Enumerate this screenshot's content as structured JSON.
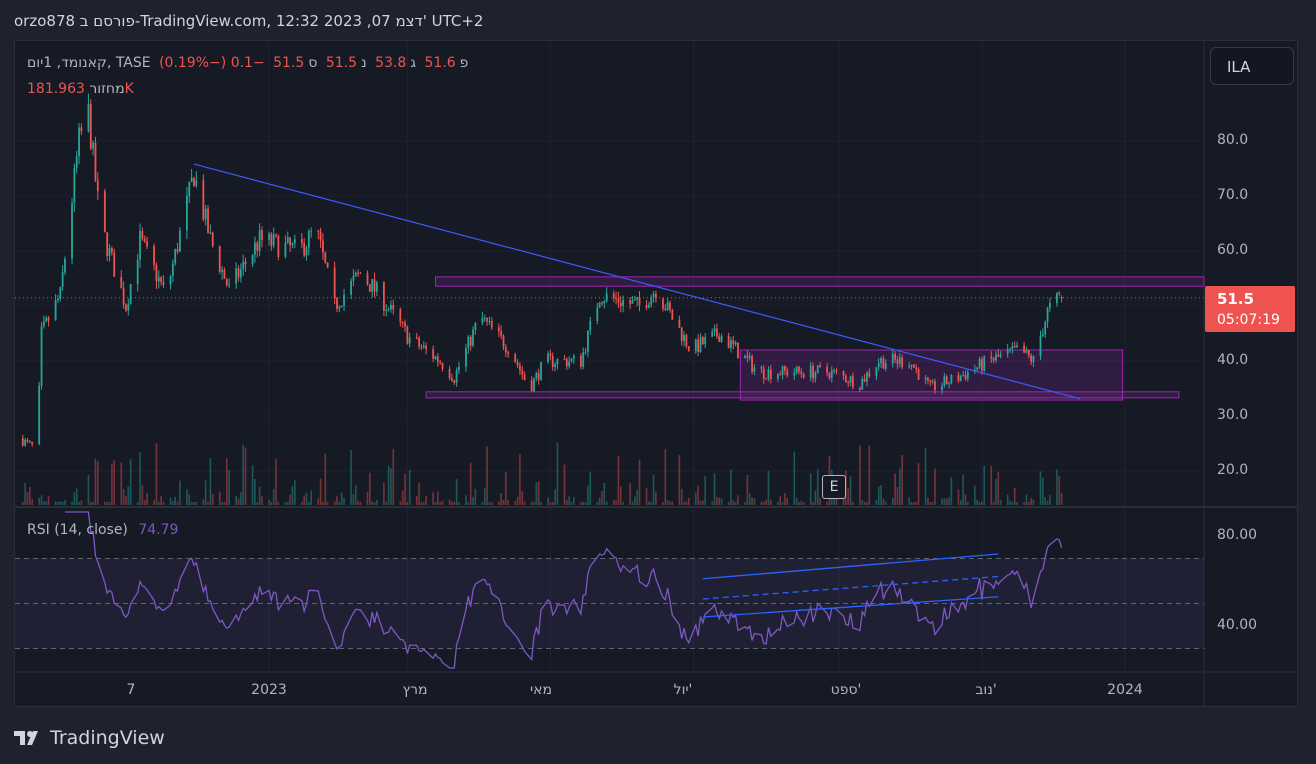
{
  "header": {
    "title": "orzo878 פורסם ב-TradingView.com, 12:32 2023 ,07 דצמ' UTC+2"
  },
  "legend": {
    "symbol": "קאנומד, 1יום, TASE",
    "o_label": "פ",
    "o": "51.6",
    "h_label": "ג",
    "h": "53.8",
    "l_label": "נ",
    "l": "51.5",
    "c_label": "ס",
    "c": "51.5",
    "change": "−0.1 (−0.19%)",
    "volume_label": "מחזור",
    "volume": "181.963K"
  },
  "rsi_legend": {
    "label": "RSI (14, close)",
    "value": "74.79"
  },
  "currency": "ILA",
  "price_axis": [
    "80.0",
    "70.0",
    "60.0",
    "40.0",
    "30.0",
    "20.0"
  ],
  "rsi_axis": [
    "80.00",
    "40.00"
  ],
  "last_price": {
    "price": "51.5",
    "countdown": "05:07:19"
  },
  "event_marker": "E",
  "time_axis": [
    {
      "label": "7",
      "day": -177
    },
    {
      "label": "2023",
      "day": 0
    },
    {
      "label": "מרץ",
      "day": 59
    },
    {
      "label": "מאי",
      "day": 120
    },
    {
      "label": "יול'",
      "day": 181
    },
    {
      "label": "ספט'",
      "day": 243
    },
    {
      "label": "נוב'",
      "day": 304
    },
    {
      "label": "2024",
      "day": 365
    }
  ],
  "footer": {
    "brand": "TradingView"
  },
  "colors": {
    "up": "#26a69a",
    "down": "#ef5350",
    "trend": "#3d5afe",
    "zone": "#9c27b0",
    "rsi": "#7e57c2"
  },
  "chart_data": {
    "type": "candlestick",
    "x_unit": "days from 2023-01-01",
    "close_anchors": [
      [
        -107,
        26
      ],
      [
        -99,
        24
      ],
      [
        -97,
        45
      ],
      [
        -89,
        52
      ],
      [
        -81,
        80
      ],
      [
        -77,
        85
      ],
      [
        -72,
        65
      ],
      [
        -61,
        50
      ],
      [
        -55,
        62
      ],
      [
        -44,
        52
      ],
      [
        -32,
        74
      ],
      [
        -25,
        62
      ],
      [
        -17,
        53
      ],
      [
        -4,
        62
      ],
      [
        13,
        60
      ],
      [
        20,
        64
      ],
      [
        28,
        50
      ],
      [
        39,
        56
      ],
      [
        47,
        52
      ],
      [
        60,
        44
      ],
      [
        73,
        40
      ],
      [
        79,
        37
      ],
      [
        90,
        48
      ],
      [
        103,
        42
      ],
      [
        111,
        35
      ],
      [
        118,
        40
      ],
      [
        133,
        40
      ],
      [
        141,
        52
      ],
      [
        158,
        50
      ],
      [
        165,
        53
      ],
      [
        180,
        42
      ],
      [
        192,
        45
      ],
      [
        209,
        38
      ],
      [
        226,
        38
      ],
      [
        239,
        38
      ],
      [
        252,
        36
      ],
      [
        260,
        40
      ],
      [
        273,
        40
      ],
      [
        282,
        35
      ],
      [
        294,
        37
      ],
      [
        307,
        40
      ],
      [
        320,
        42
      ],
      [
        326,
        40
      ],
      [
        332,
        49
      ],
      [
        338,
        52
      ]
    ],
    "last": {
      "open": 51.6,
      "high": 53.8,
      "low": 51.5,
      "close": 51.5,
      "volume": 181963
    },
    "ylim": [
      13,
      92
    ],
    "drawings": {
      "trendline": [
        [
          -32,
          75.8
        ],
        [
          346,
          33.1
        ]
      ],
      "resistance_zone": {
        "from_day": 71,
        "to_day": 400,
        "low": 53.6,
        "high": 55.3
      },
      "support_zone": {
        "from_day": 67,
        "to_day": 388,
        "low": 33.3,
        "high": 34.4
      },
      "range_box": {
        "from_day": 201,
        "to_day": 364,
        "low": 32.9,
        "high": 42.0
      }
    },
    "rsi": {
      "period": 14,
      "levels": [
        70,
        50,
        30
      ],
      "ylim": [
        20,
        90
      ],
      "last": 74.79,
      "channel": {
        "from_day": 185,
        "to_day": 311,
        "upper": [
          61,
          72
        ],
        "mid": [
          52,
          62
        ],
        "lower": [
          44,
          53
        ]
      }
    }
  }
}
